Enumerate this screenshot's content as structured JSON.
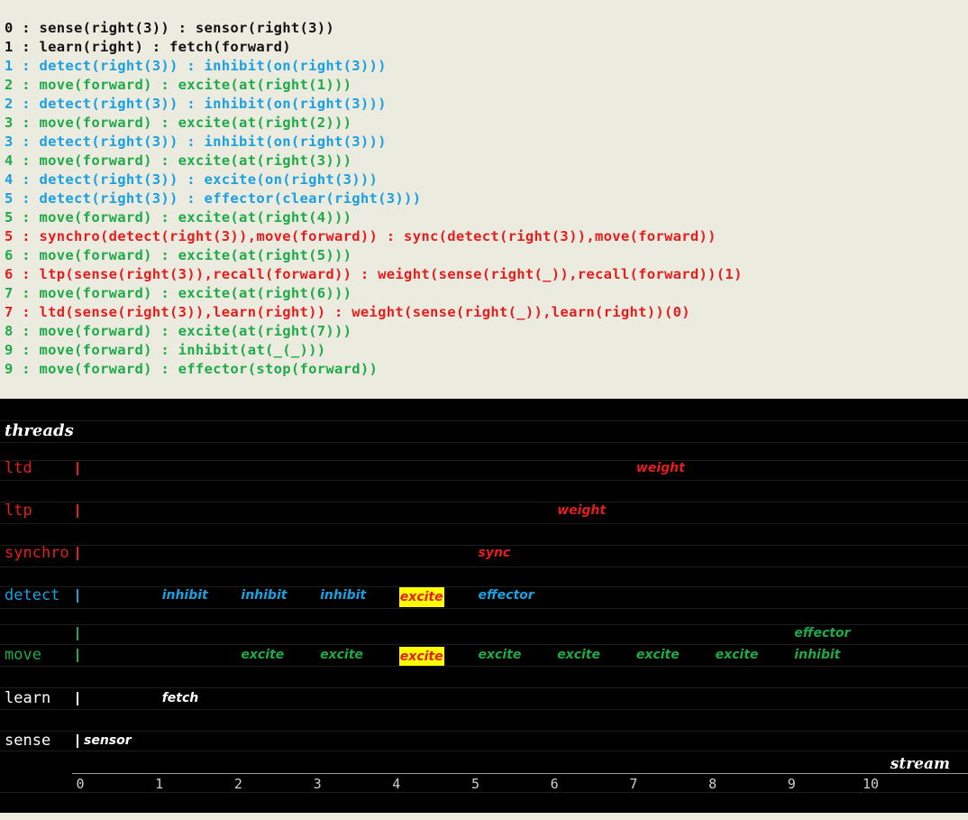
{
  "colors": {
    "black": "#111111",
    "blue": "#1aa0e0",
    "green": "#1faa4a",
    "red": "#e41e1e",
    "white": "#ffffff",
    "highlight": "#ffff00"
  },
  "log": [
    {
      "text": "0 : sense(right(3)) : sensor(right(3))",
      "color": "black"
    },
    {
      "text": "1 : learn(right) : fetch(forward)",
      "color": "black"
    },
    {
      "text": "1 : detect(right(3)) : inhibit(on(right(3)))",
      "color": "blue"
    },
    {
      "text": "2 : move(forward) : excite(at(right(1)))",
      "color": "green"
    },
    {
      "text": "2 : detect(right(3)) : inhibit(on(right(3)))",
      "color": "blue"
    },
    {
      "text": "3 : move(forward) : excite(at(right(2)))",
      "color": "green"
    },
    {
      "text": "3 : detect(right(3)) : inhibit(on(right(3)))",
      "color": "blue"
    },
    {
      "text": "4 : move(forward) : excite(at(right(3)))",
      "color": "green"
    },
    {
      "text": "4 : detect(right(3)) : excite(on(right(3)))",
      "color": "blue"
    },
    {
      "text": "5 : detect(right(3)) : effector(clear(right(3)))",
      "color": "blue"
    },
    {
      "text": "5 : move(forward) : excite(at(right(4)))",
      "color": "green"
    },
    {
      "text": "5 : synchro(detect(right(3)),move(forward)) : sync(detect(right(3)),move(forward))",
      "color": "red"
    },
    {
      "text": "6 : move(forward) : excite(at(right(5)))",
      "color": "green"
    },
    {
      "text": "6 : ltp(sense(right(3)),recall(forward)) : weight(sense(right(_)),recall(forward))(1)",
      "color": "red"
    },
    {
      "text": "7 : move(forward) : excite(at(right(6)))",
      "color": "green"
    },
    {
      "text": "7 : ltd(sense(right(3)),learn(right)) : weight(sense(right(_)),learn(right))(0)",
      "color": "red"
    },
    {
      "text": "8 : move(forward) : excite(at(right(7)))",
      "color": "green"
    },
    {
      "text": "9 : move(forward) : inhibit(at(_(_)))",
      "color": "green"
    },
    {
      "text": "9 : move(forward) : effector(stop(forward))",
      "color": "green"
    }
  ],
  "timeline": {
    "title": "threads",
    "axis_label": "stream",
    "ticks": [
      "0",
      "1",
      "2",
      "3",
      "4",
      "5",
      "6",
      "7",
      "8",
      "9",
      "10"
    ],
    "threads": [
      {
        "id": "ltd",
        "label": "ltd",
        "color": "red",
        "events": [
          {
            "t": 7,
            "label": "weight"
          }
        ]
      },
      {
        "id": "ltp",
        "label": "ltp",
        "color": "red",
        "events": [
          {
            "t": 6,
            "label": "weight"
          }
        ]
      },
      {
        "id": "synchro",
        "label": "synchro",
        "color": "red",
        "events": [
          {
            "t": 5,
            "label": "sync"
          }
        ]
      },
      {
        "id": "detect",
        "label": "detect",
        "color": "blue",
        "events": [
          {
            "t": 1,
            "label": "inhibit"
          },
          {
            "t": 2,
            "label": "inhibit"
          },
          {
            "t": 3,
            "label": "inhibit"
          },
          {
            "t": 4,
            "label": "excite",
            "highlight": true
          },
          {
            "t": 5,
            "label": "effector"
          }
        ]
      },
      {
        "id": "move-sub",
        "label": "",
        "color": "green",
        "events": [
          {
            "t": 9,
            "label": "effector"
          }
        ]
      },
      {
        "id": "move",
        "label": "move",
        "color": "green",
        "events": [
          {
            "t": 2,
            "label": "excite"
          },
          {
            "t": 3,
            "label": "excite"
          },
          {
            "t": 4,
            "label": "excite",
            "highlight": true
          },
          {
            "t": 5,
            "label": "excite"
          },
          {
            "t": 6,
            "label": "excite"
          },
          {
            "t": 7,
            "label": "excite"
          },
          {
            "t": 8,
            "label": "excite"
          },
          {
            "t": 9,
            "label": "inhibit"
          }
        ]
      },
      {
        "id": "learn",
        "label": "learn",
        "color": "white",
        "events": [
          {
            "t": 1,
            "label": "fetch"
          }
        ]
      },
      {
        "id": "sense",
        "label": "sense",
        "color": "white",
        "events": [
          {
            "t": 0,
            "label": "sensor"
          }
        ]
      }
    ]
  }
}
